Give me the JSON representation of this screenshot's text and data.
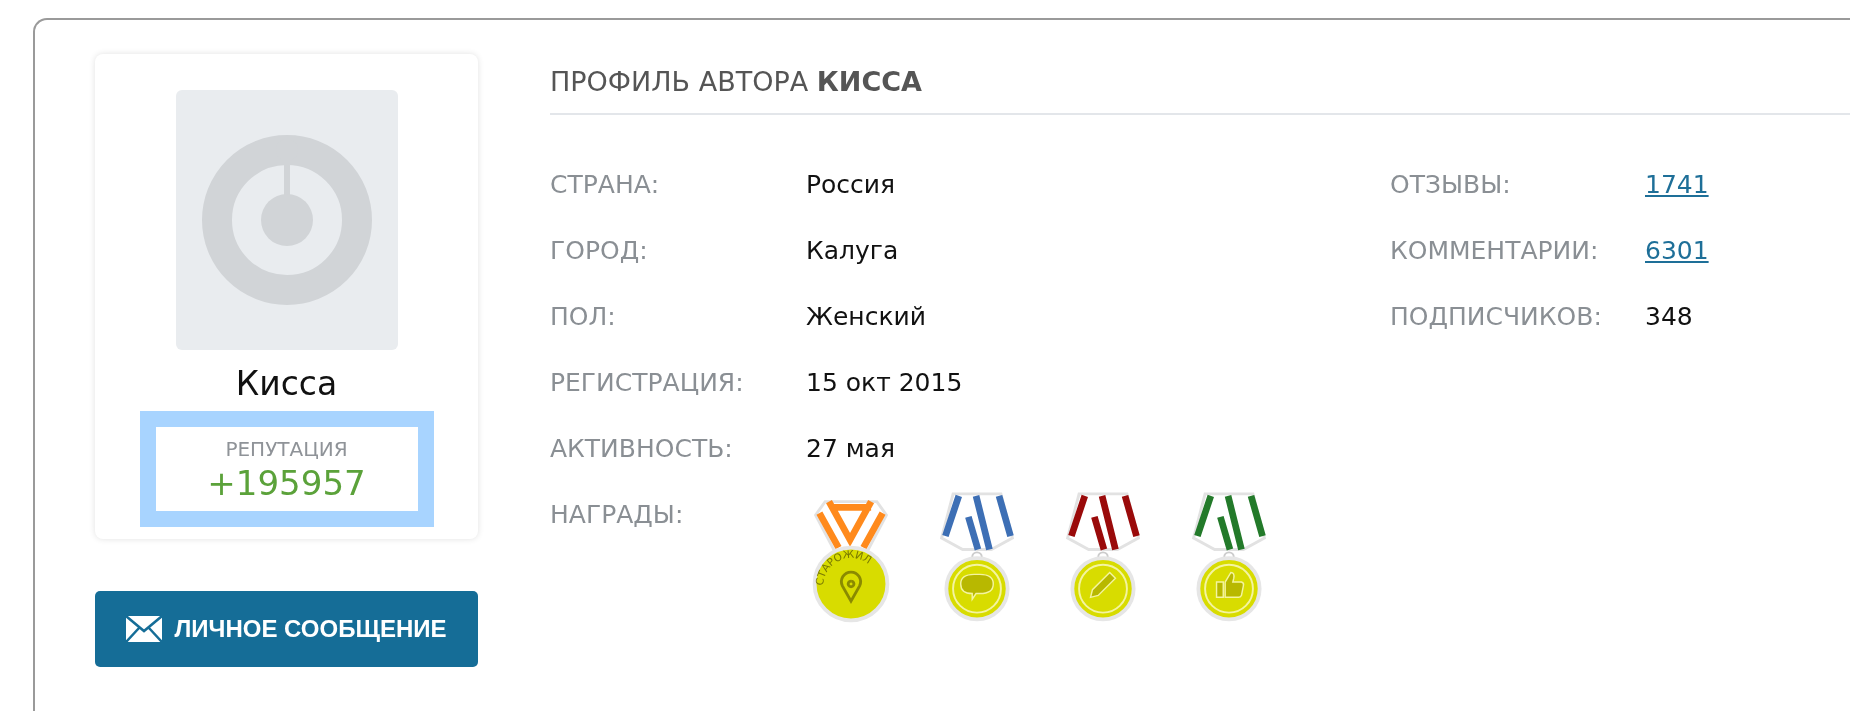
{
  "profile": {
    "name": "Кисса",
    "reputation_label": "РЕПУТАЦИЯ",
    "reputation": "+195957"
  },
  "message_button": {
    "label": "ЛИЧНОЕ СООБЩЕНИЕ"
  },
  "heading": "ПРОФИЛЬ АВТОРА **КИССА**",
  "details": [
    {
      "label": "СТРАНА:",
      "value": "Россия"
    },
    {
      "label": "ГОРОД:",
      "value": "Калуга"
    },
    {
      "label": "ПОЛ:",
      "value": "Женский"
    },
    {
      "label": "РЕГИСТРАЦИЯ:",
      "value": "15 окт 2015"
    },
    {
      "label": "АКТИВНОСТЬ:",
      "value": "27 мая"
    }
  ],
  "stats": [
    {
      "label": "ОТЗЫВЫ:",
      "value": "1741",
      "kind": "link"
    },
    {
      "label": "КОММЕНТАРИИ:",
      "value": "6301",
      "kind": "link"
    },
    {
      "label": "ПОДПИСЧИКОВ:",
      "value": "348",
      "kind": "plain"
    }
  ],
  "awards_label": "НАГРАДЫ:",
  "awards": [
    {
      "kind": "pin",
      "color": "#ff8a1c",
      "label": "СТАРОЖИЛ"
    },
    {
      "kind": "speech",
      "color": "#3d6fb5"
    },
    {
      "kind": "pencil",
      "color": "#9a0a0a"
    },
    {
      "kind": "thumb",
      "color": "#237a2a"
    }
  ]
}
